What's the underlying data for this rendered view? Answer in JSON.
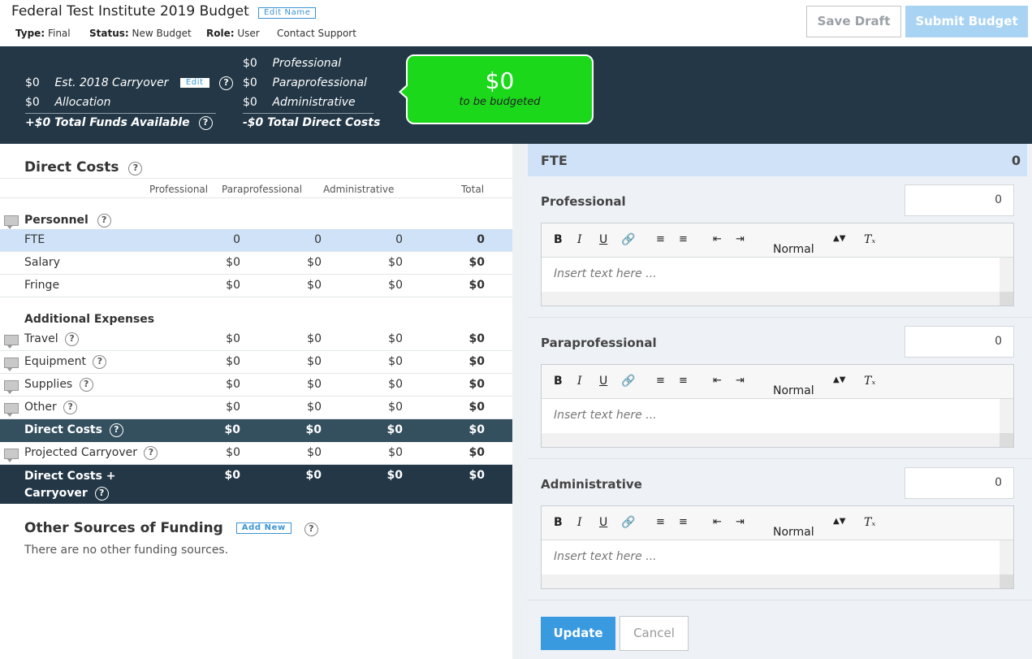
{
  "header": {
    "title": "Federal Test Institute 2019 Budget",
    "edit_name": "Edit Name",
    "type_label": "Type:",
    "type_value": "Final",
    "status_label": "Status:",
    "status_value": "New Budget",
    "role_label": "Role:",
    "role_value": "User",
    "contact": "Contact Support",
    "save_draft": "Save Draft",
    "submit": "Submit Budget"
  },
  "funds": {
    "carryover_amt": "$0",
    "carryover_label": "Est. 2018 Carryover",
    "edit": "Edit",
    "allocation_amt": "$0",
    "allocation_label": "Allocation",
    "total_available": "+$0 Total Funds Available",
    "prof_amt": "$0",
    "prof_label": "Professional",
    "para_amt": "$0",
    "para_label": "Paraprofessional",
    "admin_amt": "$0",
    "admin_label": "Administrative",
    "total_direct": "-$0 Total Direct Costs",
    "budget_amount": "$0",
    "budget_label": "to be budgeted",
    "bubble_color": "#1bd81b"
  },
  "direct_costs": {
    "title": "Direct Costs",
    "columns": [
      "Professional",
      "Paraprofessional",
      "Administrative",
      "Total"
    ],
    "personnel_title": "Personnel",
    "personnel_rows": [
      {
        "label": "FTE",
        "v": [
          "0",
          "0",
          "0",
          "0"
        ]
      },
      {
        "label": "Salary",
        "v": [
          "$0",
          "$0",
          "$0",
          "$0"
        ]
      },
      {
        "label": "Fringe",
        "v": [
          "$0",
          "$0",
          "$0",
          "$0"
        ]
      }
    ],
    "additional_title": "Additional Expenses",
    "additional_rows": [
      {
        "label": "Travel",
        "v": [
          "$0",
          "$0",
          "$0",
          "$0"
        ]
      },
      {
        "label": "Equipment",
        "v": [
          "$0",
          "$0",
          "$0",
          "$0"
        ]
      },
      {
        "label": "Supplies",
        "v": [
          "$0",
          "$0",
          "$0",
          "$0"
        ]
      },
      {
        "label": "Other",
        "v": [
          "$0",
          "$0",
          "$0",
          "$0"
        ]
      }
    ],
    "direct_costs_row": {
      "label": "Direct Costs",
      "v": [
        "$0",
        "$0",
        "$0",
        "$0"
      ]
    },
    "projected_row": {
      "label": "Projected Carryover",
      "v": [
        "$0",
        "$0",
        "$0",
        "$0"
      ]
    },
    "dc_carryover_row": {
      "label1": "Direct Costs +",
      "label2": "Carryover",
      "v": [
        "$0",
        "$0",
        "$0",
        "$0"
      ]
    }
  },
  "other_funding": {
    "title": "Other Sources of Funding",
    "add_new": "Add New",
    "empty": "There are no other funding sources."
  },
  "editor_panel": {
    "title": "FTE",
    "total": "0",
    "sections": [
      {
        "name": "Professional",
        "value": "0",
        "placeholder": "Insert text here ..."
      },
      {
        "name": "Paraprofessional",
        "value": "0",
        "placeholder": "Insert text here ..."
      },
      {
        "name": "Administrative",
        "value": "0",
        "placeholder": "Insert text here ..."
      }
    ],
    "format_option": "Normal",
    "update": "Update",
    "cancel": "Cancel"
  }
}
